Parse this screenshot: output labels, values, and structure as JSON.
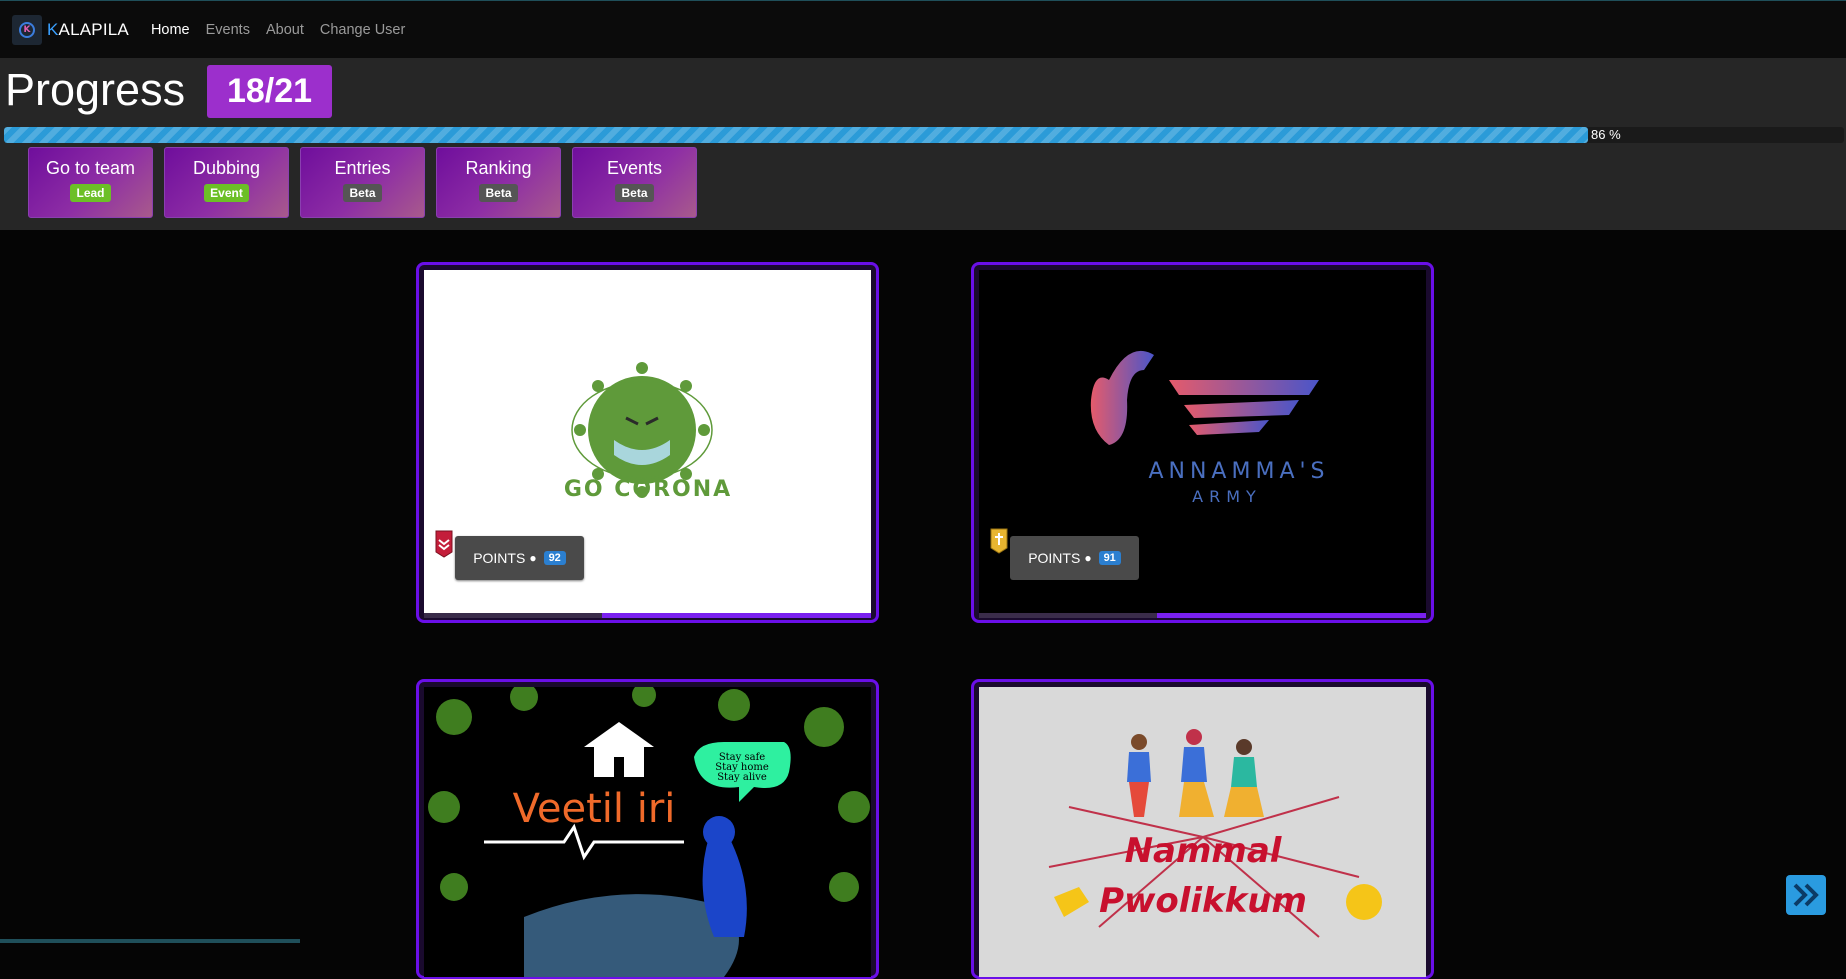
{
  "navbar": {
    "brand_k": "K",
    "brand_rest": "ALAPILA",
    "links": [
      {
        "label": "Home",
        "active": true
      },
      {
        "label": "Events",
        "active": false
      },
      {
        "label": "About",
        "active": false
      },
      {
        "label": "Change User",
        "active": false
      }
    ]
  },
  "progress": {
    "title": "Progress",
    "count": "18/21",
    "percent_label": "86 %",
    "percent_value": 86
  },
  "tabs": [
    {
      "label": "Go to team",
      "badge": "Lead",
      "badge_color": "#6cbf26"
    },
    {
      "label": "Dubbing",
      "badge": "Event",
      "badge_color": "#6cbf26"
    },
    {
      "label": "Entries",
      "badge": "Beta",
      "badge_color": "#555555"
    },
    {
      "label": "Ranking",
      "badge": "Beta",
      "badge_color": "#555555"
    },
    {
      "label": "Events",
      "badge": "Beta",
      "badge_color": "#555555"
    }
  ],
  "teams": [
    {
      "name_line1": "GO CORONA",
      "points_label": "POINTS",
      "points": "92",
      "rank_icon": "chevron-rank-icon"
    },
    {
      "name_line1": "ANNAMMA'S",
      "name_line2": "ARMY",
      "points_label": "POINTS",
      "points": "91",
      "rank_icon": "gold-rank-icon"
    },
    {
      "name_line1": "Veetil iri",
      "bubble": [
        "Stay safe",
        "Stay home",
        "Stay alive"
      ]
    },
    {
      "name_line1": "Nammal",
      "name_line2": "Pwolikkum"
    }
  ],
  "colors": {
    "accent": "#9c2fcc",
    "card_border": "#6a0fe8",
    "progress": "#2b9bd8"
  }
}
